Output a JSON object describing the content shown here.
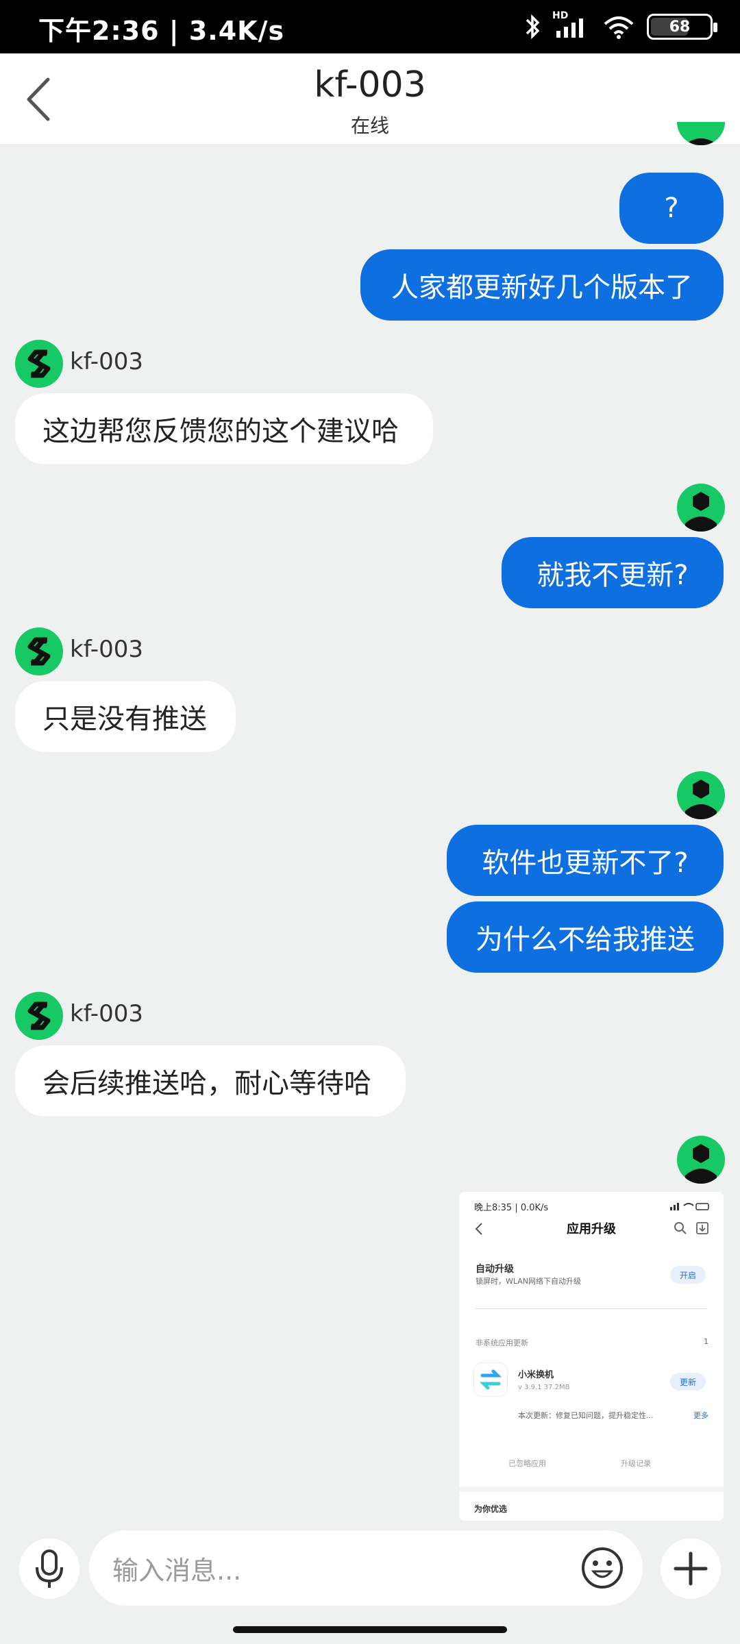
{
  "status_bar": {
    "time_speed": "下午2:36 | 3.4K/s",
    "network": "HD",
    "battery": "68"
  },
  "header": {
    "title": "kf-003",
    "subtitle": "在线"
  },
  "messages": {
    "out1": "?",
    "out2": "人家都更新好几个版本了",
    "in1_name": "kf-003",
    "in1": "这边帮您反馈您的这个建议哈",
    "out3": "就我不更新?",
    "in2_name": "kf-003",
    "in2": "只是没有推送",
    "out4": "软件也更新不了?",
    "out5": "为什么不给我推送",
    "in3_name": "kf-003",
    "in3": "会后续推送哈，耐心等待哈"
  },
  "screenshot": {
    "status": "晚上8:35 | 0.0K/s",
    "title": "应用升级",
    "auto_title": "自动升级",
    "auto_desc": "锁屏时，WLAN网络下自动升级",
    "auto_btn": "开启",
    "section": "非系统应用更新",
    "section_count": "1",
    "app_name": "小米换机",
    "app_meta": "v 3.9.1    37.2MB",
    "app_btn": "更新",
    "app_note": "本次更新：修复已知问题，提升稳定性...",
    "more": "更多",
    "ignored": "已忽略应用",
    "history": "升级记录",
    "for_you": "为你优选"
  },
  "composer": {
    "placeholder": "输入消息..."
  }
}
